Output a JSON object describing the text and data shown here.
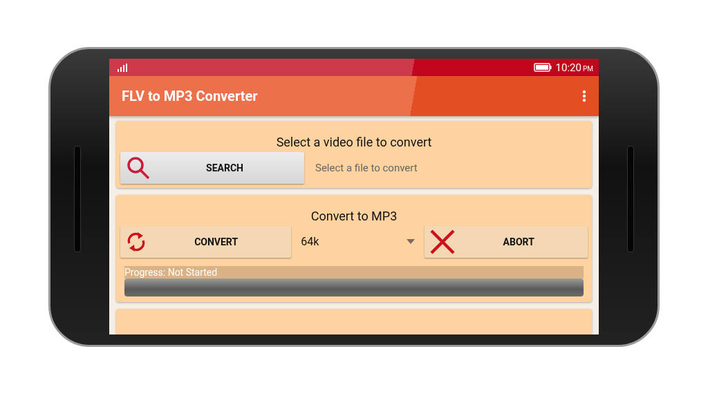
{
  "status_bar": {
    "time": "10:20",
    "period": "PM"
  },
  "app_bar": {
    "title": "FLV to MP3 Converter"
  },
  "select_card": {
    "title": "Select a video file to convert",
    "button": "SEARCH",
    "file_placeholder": "Select a file to convert"
  },
  "convert_card": {
    "title": "Convert to MP3",
    "convert_button": "CONVERT",
    "bitrate": "64k",
    "abort_button": "ABORT",
    "progress_label": "Progress: Not Started",
    "progress": {
      "level": 0
    }
  }
}
